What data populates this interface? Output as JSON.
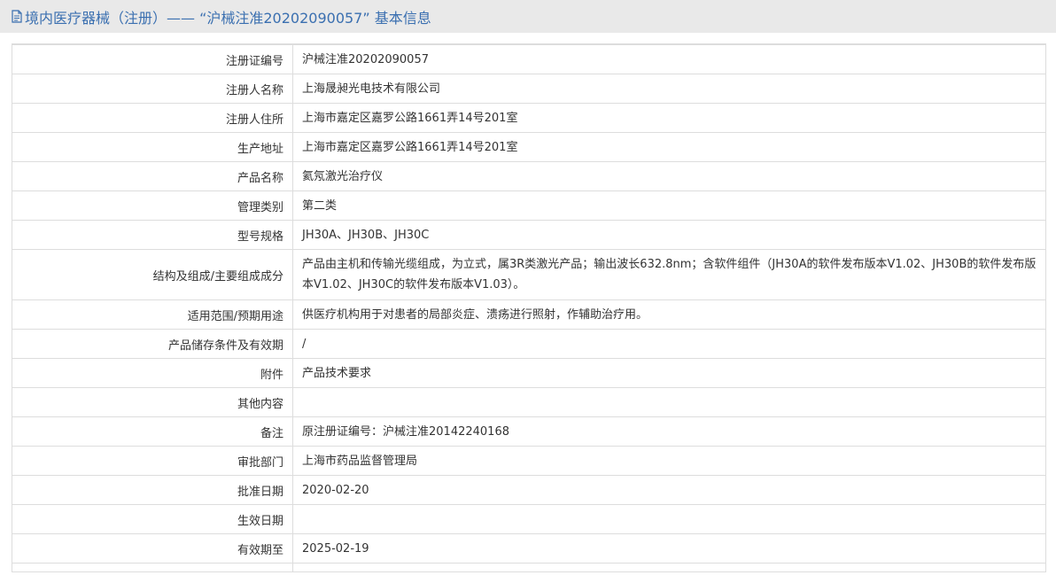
{
  "header": {
    "icon": "document-icon",
    "title": "境内医疗器械（注册）——  “沪械注准20202090057”  基本信息"
  },
  "rows": [
    {
      "label": "注册证编号",
      "value": "沪械注准20202090057"
    },
    {
      "label": "注册人名称",
      "value": "上海晟昶光电技术有限公司"
    },
    {
      "label": "注册人住所",
      "value": "上海市嘉定区嘉罗公路1661弄14号201室"
    },
    {
      "label": "生产地址",
      "value": "上海市嘉定区嘉罗公路1661弄14号201室"
    },
    {
      "label": "产品名称",
      "value": "氦氖激光治疗仪"
    },
    {
      "label": "管理类别",
      "value": "第二类"
    },
    {
      "label": "型号规格",
      "value": "JH30A、JH30B、JH30C"
    },
    {
      "label": "结构及组成/主要组成成分",
      "value": "产品由主机和传输光缆组成，为立式，属3R类激光产品；输出波长632.8nm；含软件组件（JH30A的软件发布版本V1.02、JH30B的软件发布版本V1.02、JH30C的软件发布版本V1.03）。"
    },
    {
      "label": "适用范围/预期用途",
      "value": "供医疗机构用于对患者的局部炎症、溃疡进行照射，作辅助治疗用。"
    },
    {
      "label": "产品储存条件及有效期",
      "value": "/"
    },
    {
      "label": "附件",
      "value": "产品技术要求"
    },
    {
      "label": "其他内容",
      "value": ""
    },
    {
      "label": "备注",
      "value": "原注册证编号：沪械注准20142240168"
    },
    {
      "label": "审批部门",
      "value": "上海市药品监督管理局"
    },
    {
      "label": "批准日期",
      "value": "2020-02-20"
    },
    {
      "label": "生效日期",
      "value": ""
    },
    {
      "label": "有效期至",
      "value": "2025-02-19"
    }
  ]
}
